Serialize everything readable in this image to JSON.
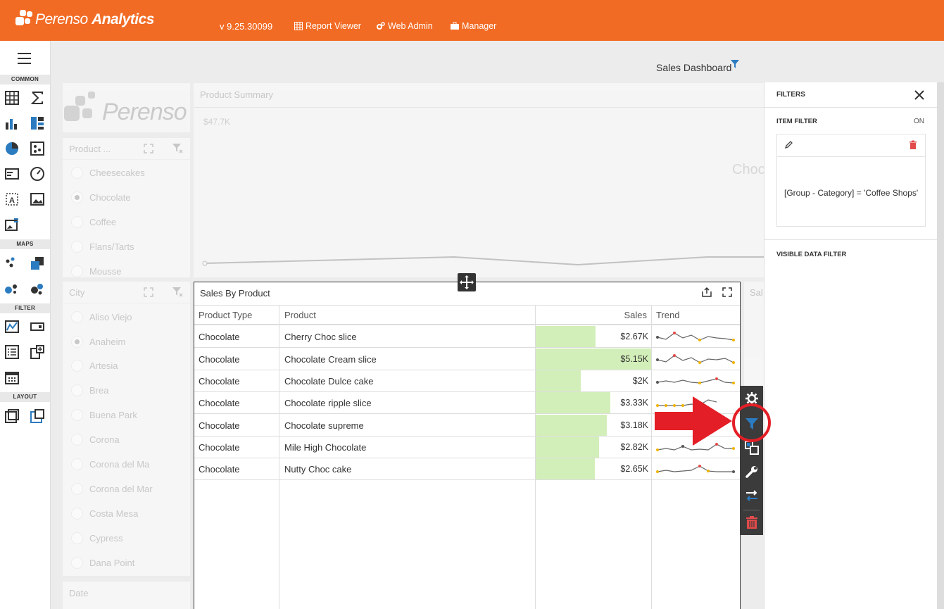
{
  "header": {
    "logo_regular": "Perenso",
    "logo_bold": "Analytics",
    "version": "v 9.25.30099",
    "nav": [
      {
        "label": "Report Viewer",
        "icon": "grid-icon"
      },
      {
        "label": "Web Admin",
        "icon": "gears-icon"
      },
      {
        "label": "Manager",
        "icon": "briefcase-icon"
      }
    ],
    "colors": {
      "brand": "#f26b24"
    }
  },
  "toolbox": {
    "sections": [
      "COMMON",
      "MAPS",
      "FILTER",
      "LAYOUT"
    ]
  },
  "dashboard": {
    "title": "Sales Dashboard"
  },
  "product_summary": {
    "title": "Product Summary",
    "value_label": "$47.7K",
    "partial_label": "Choc",
    "logo_text": "Perenso"
  },
  "product_filter": {
    "title": "Product ...",
    "items": [
      "Cheesecakes",
      "Chocolate",
      "Coffee",
      "Flans/Tarts",
      "Mousse"
    ],
    "selected": "Chocolate"
  },
  "city_filter": {
    "title": "City",
    "items": [
      "Aliso Viejo",
      "Anaheim",
      "Artesia",
      "Brea",
      "Buena Park",
      "Corona",
      "Corona del Ma",
      "Corona del Mar",
      "Costa Mesa",
      "Cypress",
      "Dana Point"
    ],
    "selected": "Anaheim"
  },
  "date_filter": {
    "title": "Date"
  },
  "sales_by_product": {
    "title": "Sales By Product",
    "partial_neighbor_title": "Sal",
    "columns": [
      "Product Type",
      "Product",
      "Sales",
      "Trend"
    ],
    "max_sales": 5.15,
    "rows": [
      {
        "type": "Chocolate",
        "product": "Cherry Choc slice",
        "sales": "$2.67K",
        "value": 2.67
      },
      {
        "type": "Chocolate",
        "product": "Chocolate Cream slice",
        "sales": "$5.15K",
        "value": 5.15
      },
      {
        "type": "Chocolate",
        "product": "Chocolate Dulce cake",
        "sales": "$2K",
        "value": 2.0
      },
      {
        "type": "Chocolate",
        "product": "Chocolate ripple slice",
        "sales": "$3.33K",
        "value": 3.33
      },
      {
        "type": "Chocolate",
        "product": "Chocolate supreme",
        "sales": "$3.18K",
        "value": 3.18
      },
      {
        "type": "Chocolate",
        "product": "Mile High Chocolate",
        "sales": "$2.82K",
        "value": 2.82
      },
      {
        "type": "Chocolate",
        "product": "Nutty Choc cake",
        "sales": "$2.65K",
        "value": 2.65
      }
    ]
  },
  "filters_panel": {
    "title": "FILTERS",
    "item_filter_label": "ITEM FILTER",
    "item_filter_state": "ON",
    "expression": "[Group - Category] = 'Coffee Shops'",
    "visible_data_filter_label": "VISIBLE DATA FILTER"
  }
}
